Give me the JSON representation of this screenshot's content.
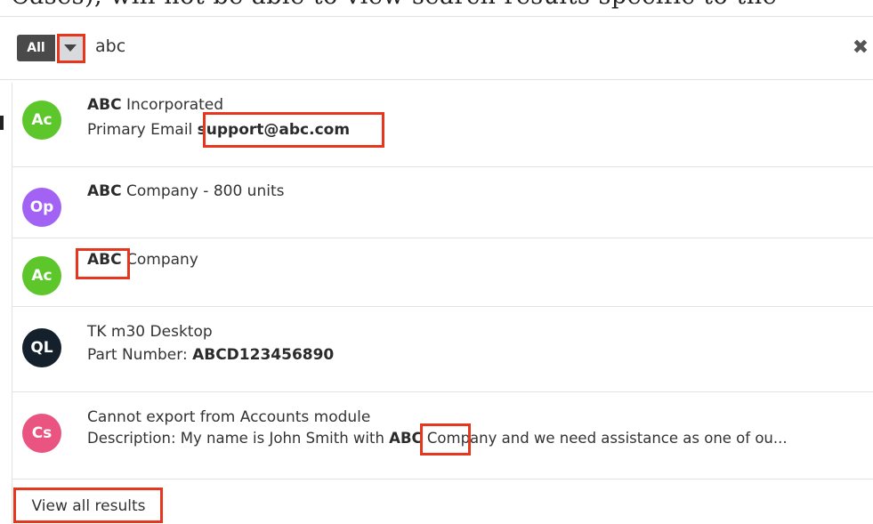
{
  "background_text": "Cases), will not be able to view search results specific to the",
  "search": {
    "scope_label": "All",
    "query": "abc",
    "clear_glyph": "✖"
  },
  "results": [
    {
      "avatar": "Ac",
      "avatar_color": "#5cc62b",
      "title_bold": "ABC",
      "title_rest": " Incorporated",
      "detail_label": "Primary Email ",
      "detail_bold": "support@abc.com"
    },
    {
      "avatar": "Op",
      "avatar_color": "#a263f5",
      "title_bold": "ABC",
      "title_rest": " Company - 800 units"
    },
    {
      "avatar": "Ac",
      "avatar_color": "#5cc62b",
      "title_bold": "ABC",
      "title_rest": " Company"
    },
    {
      "avatar": "QL",
      "avatar_color": "#14202b",
      "title_rest": "TK m30 Desktop",
      "detail_label": "Part Number: ",
      "detail_bold": "ABCD123456890"
    },
    {
      "avatar": "Cs",
      "avatar_color": "#e95580",
      "title_rest": "Cannot export from Accounts module",
      "detail_label": "Description: My name is John Smith with ",
      "detail_bold": "ABC",
      "detail_rest": " Company and we need assistance as one of ou..."
    }
  ],
  "footer": {
    "view_all_label": "View all results"
  },
  "colors": {
    "highlight_border": "#e6361d",
    "divider": "#e2e2e2"
  }
}
